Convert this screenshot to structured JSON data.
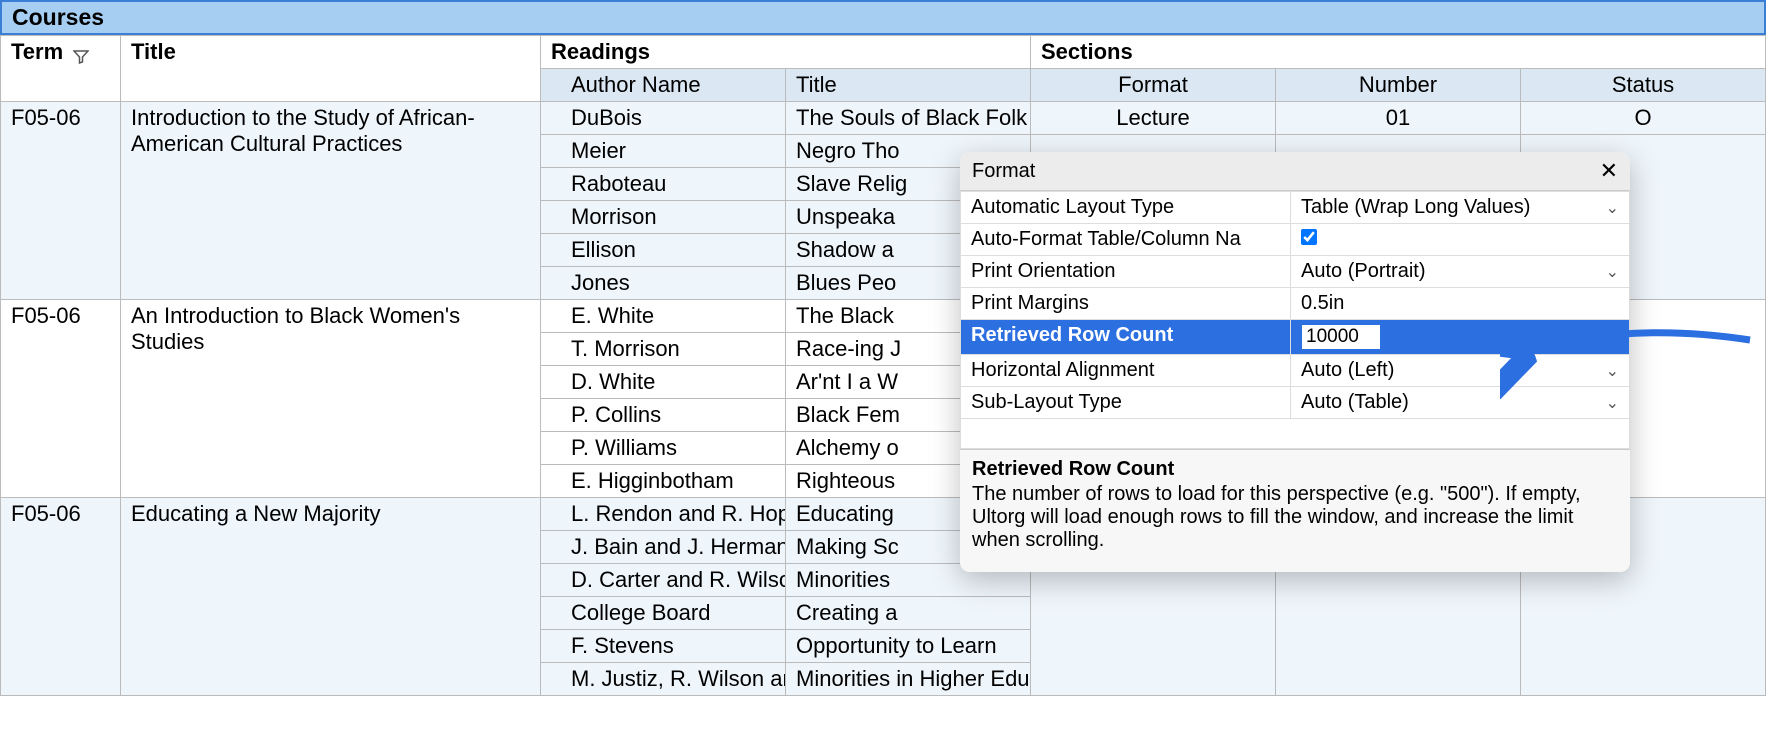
{
  "titleBar": "Courses",
  "headers": {
    "term": "Term",
    "title": "Title",
    "readings": "Readings",
    "sections": "Sections",
    "authorName": "Author Name",
    "rTitle": "Title",
    "format": "Format",
    "number": "Number",
    "status": "Status"
  },
  "rows": [
    {
      "term": "F05-06",
      "title": "Introduction to the Study of African-American Cultural Practices",
      "readings": [
        {
          "author": "DuBois",
          "title": "The Souls of Black Folk"
        },
        {
          "author": "Meier",
          "title": "Negro Tho"
        },
        {
          "author": "Raboteau",
          "title": "Slave Relig"
        },
        {
          "author": "Morrison",
          "title": "Unspeaka"
        },
        {
          "author": "Ellison",
          "title": "Shadow a"
        },
        {
          "author": "Jones",
          "title": "Blues Peo"
        }
      ],
      "section": {
        "format": "Lecture",
        "number": "01",
        "status": "O"
      }
    },
    {
      "term": "F05-06",
      "title": "An Introduction to Black Women's Studies",
      "readings": [
        {
          "author": "E. White",
          "title": "The Black"
        },
        {
          "author": "T. Morrison",
          "title": "Race-ing J"
        },
        {
          "author": "D. White",
          "title": "Ar'nt I a W"
        },
        {
          "author": "P. Collins",
          "title": "Black Fem"
        },
        {
          "author": "P. Williams",
          "title": "Alchemy o"
        },
        {
          "author": "E. Higginbotham",
          "title": "Righteous"
        }
      ],
      "section": null
    },
    {
      "term": "F05-06",
      "title": "Educating a New Majority",
      "readings": [
        {
          "author": "L. Rendon and R. Hope",
          "title": "Educating"
        },
        {
          "author": "J. Bain and J. Herman",
          "title": "Making Sc"
        },
        {
          "author": "D. Carter and R. Wilso",
          "title": "Minorities"
        },
        {
          "author": "College Board",
          "title": "Creating a"
        },
        {
          "author": "F. Stevens",
          "title": "Opportunity to Learn"
        },
        {
          "author": "M. Justiz, R. Wilson an",
          "title": "Minorities in Higher Educatio"
        }
      ],
      "section": null
    }
  ],
  "dialog": {
    "title": "Format",
    "closeGlyph": "✕",
    "items": [
      {
        "label": "Automatic Layout Type",
        "value": "Table (Wrap Long Values)",
        "type": "select"
      },
      {
        "label": "Auto-Format Table/Column Na",
        "value": true,
        "type": "check"
      },
      {
        "label": "Print Orientation",
        "value": "Auto (Portrait)",
        "type": "select"
      },
      {
        "label": "Print Margins",
        "value": "0.5in",
        "type": "text"
      },
      {
        "label": "Retrieved Row Count",
        "value": "10000",
        "type": "input",
        "selected": true
      },
      {
        "label": "Horizontal Alignment",
        "value": "Auto (Left)",
        "type": "select"
      },
      {
        "label": "Sub-Layout Type",
        "value": "Auto (Table)",
        "type": "select"
      }
    ],
    "helpTitle": "Retrieved Row Count",
    "helpText": "The number of rows to load for this perspective (e.g. \"500\"). If empty, Ultorg will load enough rows to fill the window, and increase the limit when scrolling."
  }
}
